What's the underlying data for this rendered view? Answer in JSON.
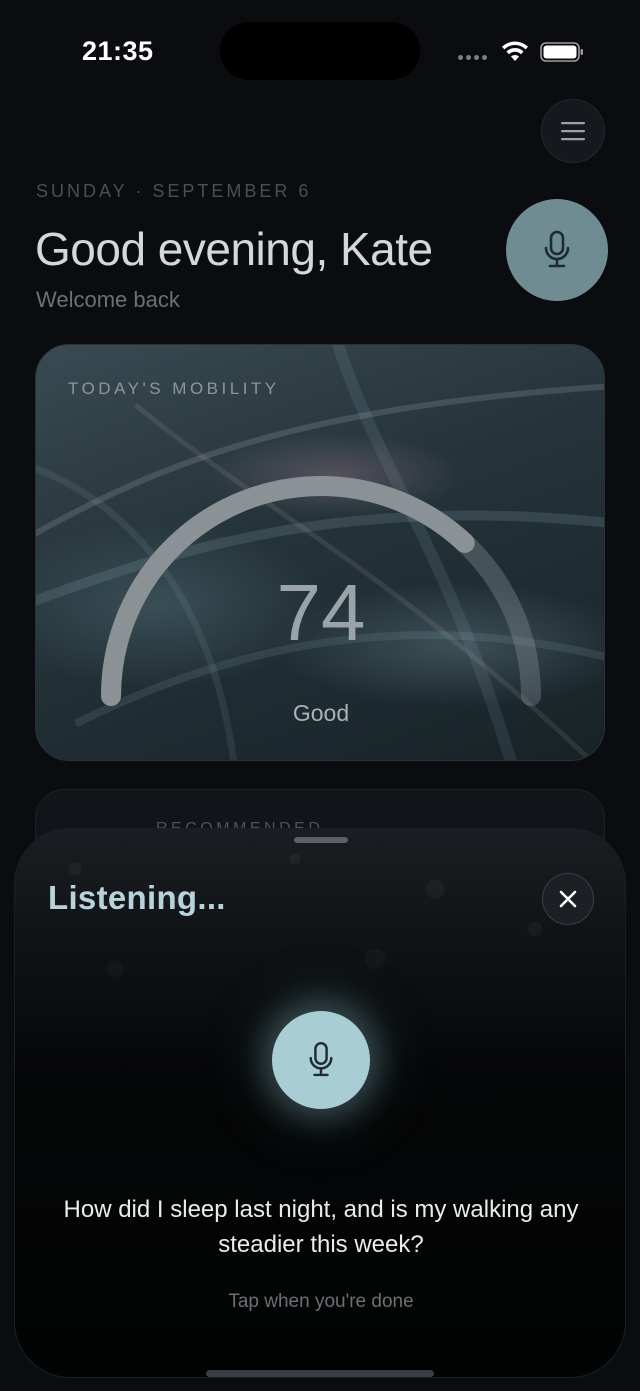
{
  "status_bar": {
    "time": "21:35"
  },
  "header": {
    "date": "SUNDAY · SEPTEMBER 6",
    "greeting": "Good evening, Kate",
    "welcome": "Welcome back"
  },
  "mobility": {
    "label": "TODAY'S MOBILITY",
    "score": "74",
    "rating": "Good",
    "score_fraction": 0.74
  },
  "recommended": {
    "label": "RECOMMENDED"
  },
  "listening_sheet": {
    "title": "Listening...",
    "transcript": "How did I sleep last night, and is my walking any steadier this week?",
    "hint": "Tap when you're done"
  },
  "colors": {
    "background": "#0a0c10",
    "accent_mic": "#a9cdd4",
    "mic_fab": "#6f8c93",
    "listening_title": "#b9d3da"
  },
  "icons": [
    "menu-icon",
    "microphone-icon",
    "close-icon",
    "wifi-icon",
    "battery-icon"
  ]
}
